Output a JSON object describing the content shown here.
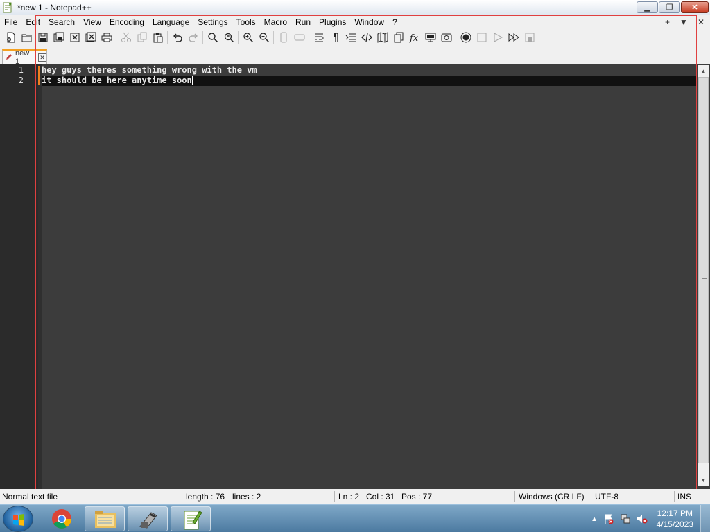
{
  "window": {
    "title": "*new 1 - Notepad++",
    "minimize_label": "▁",
    "maximize_label": "❐",
    "close_label": "✕"
  },
  "menu": {
    "items": [
      "File",
      "Edit",
      "Search",
      "View",
      "Encoding",
      "Language",
      "Settings",
      "Tools",
      "Macro",
      "Run",
      "Plugins",
      "Window",
      "?"
    ],
    "right_plus": "+",
    "right_down": "▼",
    "right_close": "✕"
  },
  "tab": {
    "label": "new 1",
    "close": "✕"
  },
  "editor": {
    "lines": [
      {
        "number": "1",
        "text": "hey guys theres something wrong with the vm"
      },
      {
        "number": "2",
        "text": "it should be here anytime soon"
      }
    ],
    "colors": {
      "background": "#3c3c3c",
      "gutter": "#2b2b2b",
      "current_line": "#111111"
    }
  },
  "status": {
    "file_type": "Normal text file",
    "length": "length : 76",
    "lines": "lines : 2",
    "ln": "Ln : 2",
    "col": "Col : 31",
    "pos": "Pos : 77",
    "eol": "Windows (CR LF)",
    "encoding": "UTF-8",
    "mode": "INS"
  },
  "taskbar": {
    "time": "12:17 PM",
    "date": "4/15/2023",
    "apps": [
      "chrome-icon",
      "file-explorer-icon",
      "vm-tool-icon",
      "notepadpp-icon"
    ]
  }
}
